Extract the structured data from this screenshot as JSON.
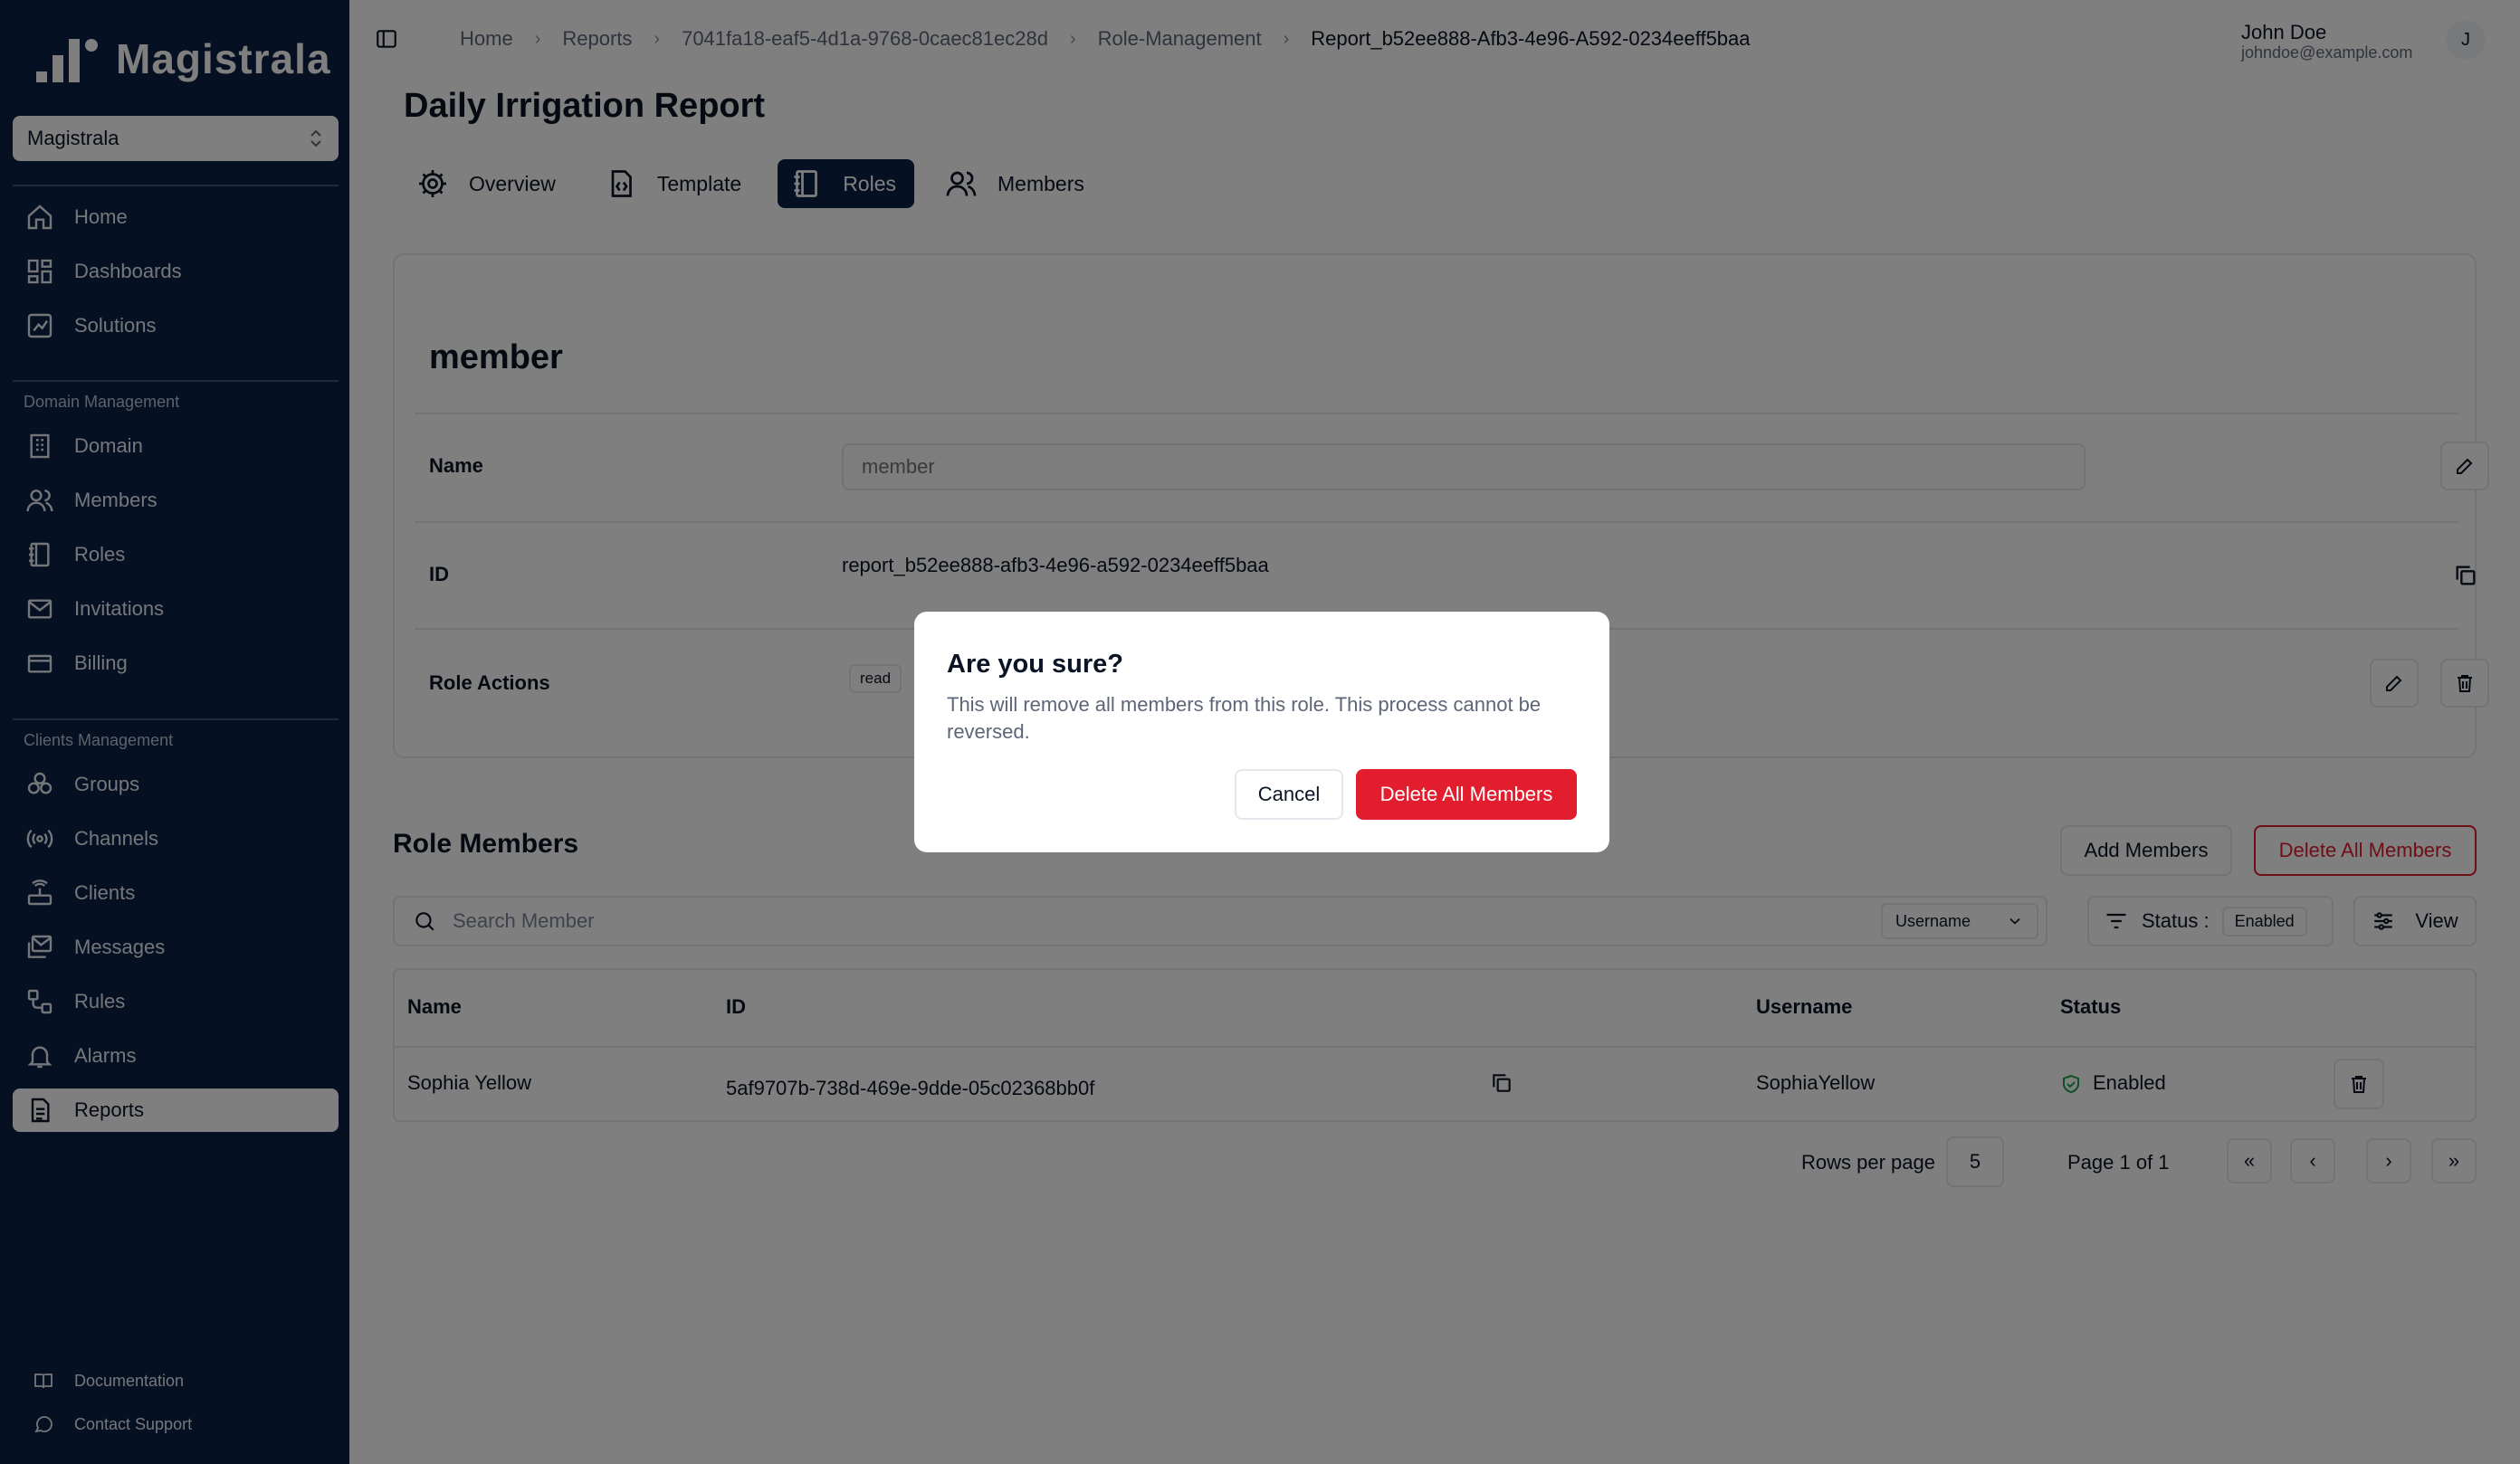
{
  "brand": {
    "name": "Magistrala"
  },
  "org_selector": {
    "value": "Magistrala"
  },
  "sidebar": {
    "primary": [
      {
        "label": "Home",
        "icon": "home-icon"
      },
      {
        "label": "Dashboards",
        "icon": "dashboard-icon"
      },
      {
        "label": "Solutions",
        "icon": "solutions-icon"
      }
    ],
    "domain_section": "Domain Management",
    "domain_items": [
      {
        "label": "Domain",
        "icon": "building-icon"
      },
      {
        "label": "Members",
        "icon": "users-icon"
      },
      {
        "label": "Roles",
        "icon": "notebook-icon"
      },
      {
        "label": "Invitations",
        "icon": "mail-icon"
      },
      {
        "label": "Billing",
        "icon": "credit-card-icon"
      }
    ],
    "clients_section": "Clients Management",
    "clients_items": [
      {
        "label": "Groups",
        "icon": "groups-icon"
      },
      {
        "label": "Channels",
        "icon": "radio-icon"
      },
      {
        "label": "Clients",
        "icon": "router-icon"
      },
      {
        "label": "Messages",
        "icon": "messages-icon"
      },
      {
        "label": "Rules",
        "icon": "workflow-icon"
      },
      {
        "label": "Alarms",
        "icon": "bell-icon"
      },
      {
        "label": "Reports",
        "icon": "file-icon",
        "active": true
      }
    ],
    "footer": [
      {
        "label": "Documentation",
        "icon": "book-icon"
      },
      {
        "label": "Contact Support",
        "icon": "chat-icon"
      }
    ]
  },
  "breadcrumb": [
    "Home",
    "Reports",
    "7041fa18-eaf5-4d1a-9768-0caec81ec28d",
    "Role-Management",
    "Report_b52ee888-Afb3-4e96-A592-0234eeff5baa"
  ],
  "user": {
    "name": "John Doe",
    "email": "johndoe@example.com",
    "initial": "J"
  },
  "page": {
    "title": "Daily Irrigation Report"
  },
  "tabs": [
    {
      "label": "Overview",
      "icon": "gear-icon"
    },
    {
      "label": "Template",
      "icon": "file-code-icon"
    },
    {
      "label": "Roles",
      "icon": "notebook-icon",
      "active": true
    },
    {
      "label": "Members",
      "icon": "users-icon"
    }
  ],
  "role": {
    "title": "member",
    "name_label": "Name",
    "name_placeholder": "member",
    "id_label": "ID",
    "id_value": "report_b52ee888-afb3-4e96-a592-0234eeff5baa",
    "actions_label": "Role Actions",
    "actions": [
      "read"
    ]
  },
  "members": {
    "title": "Role Members",
    "add_button": "Add Members",
    "delete_all_button": "Delete All Members",
    "search_placeholder": "Search Member",
    "search_by": "Username",
    "status_label": "Status :",
    "status_value": "Enabled",
    "view_label": "View",
    "columns": [
      "Name",
      "ID",
      "Username",
      "Status"
    ],
    "rows": [
      {
        "name": "Sophia Yellow",
        "id": "5af9707b-738d-469e-9dde-05c02368bb0f",
        "username": "SophiaYellow",
        "status": "Enabled"
      }
    ],
    "rows_per_page_label": "Rows per page",
    "rows_per_page": "5",
    "page_info": "Page 1 of 1",
    "pager": [
      "«",
      "‹",
      "›",
      "»"
    ]
  },
  "dialog": {
    "title": "Are you sure?",
    "message": "This will remove all members from this role. This process cannot be reversed.",
    "cancel": "Cancel",
    "confirm": "Delete All Members"
  },
  "colors": {
    "sidebar": "#0d2146",
    "danger": "#e11d2e",
    "accent": "#0d2146"
  }
}
